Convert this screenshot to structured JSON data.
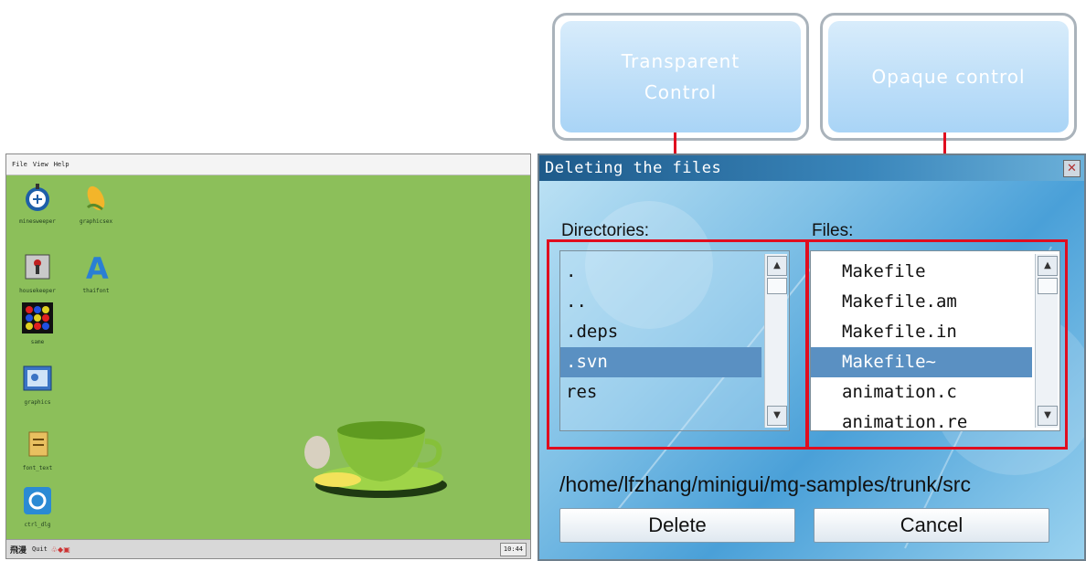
{
  "callouts": {
    "transparent": "Transparent Control",
    "opaque": "Opaque control"
  },
  "desktop": {
    "menu": [
      "File",
      "View",
      "Help"
    ],
    "icons": [
      {
        "label": "minesweeper",
        "icon": "minesweeper-icon"
      },
      {
        "label": "graphicsex",
        "icon": "graphicsex-icon"
      },
      {
        "label": "housekeeper",
        "icon": "housekeeper-icon"
      },
      {
        "label": "thaifont",
        "icon": "thaifont-icon"
      },
      {
        "label": "same",
        "icon": "same-game-icon"
      },
      {
        "label": "graphics",
        "icon": "graphics-icon"
      },
      {
        "label": "font_text",
        "icon": "font-text-icon"
      },
      {
        "label": "ctrl_dlg",
        "icon": "ctrl-dlg-icon"
      }
    ],
    "taskbar": {
      "start": "飛漫",
      "quit": "Quit",
      "clock": "10:44"
    }
  },
  "dialog": {
    "title": "Deleting the files",
    "directories_label": "Directories:",
    "files_label": "Files:",
    "directories": [
      ".",
      "..",
      ".deps",
      ".svn",
      "res"
    ],
    "directories_selected_index": 3,
    "files": [
      "Makefile",
      "Makefile.am",
      "Makefile.in",
      "Makefile~",
      "animation.c",
      "animation.re"
    ],
    "files_selected_index": 3,
    "path": "/home/lfzhang/minigui/mg-samples/trunk/src",
    "delete_label": "Delete",
    "cancel_label": "Cancel",
    "highlight_color": "#e00d1f",
    "selection_color": "#5a90c2"
  }
}
